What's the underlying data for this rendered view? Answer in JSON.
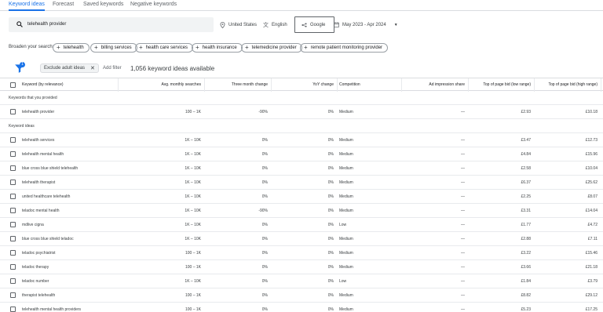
{
  "tabs": [
    {
      "label": "Keyword ideas",
      "active": true
    },
    {
      "label": "Forecast",
      "active": false
    },
    {
      "label": "Saved keywords",
      "active": false
    },
    {
      "label": "Negative keywords",
      "active": false
    }
  ],
  "search": {
    "value": "telehealth provider",
    "icon": "search-icon"
  },
  "options": {
    "location": "United States",
    "language": "English",
    "network": "Google",
    "date_range": "May 2023 - Apr 2024"
  },
  "broaden": {
    "label": "Broaden your search:",
    "chips": [
      "telehealth",
      "billing services",
      "health care services",
      "health insurance",
      "telemedicine provider",
      "remote patient monitoring provider"
    ]
  },
  "filters": {
    "badge": "1",
    "chip": "Exclude adult ideas",
    "add_filter": "Add filter",
    "count": "1,056 keyword ideas available"
  },
  "columns": [
    "Keyword (by relevance)",
    "Avg. monthly searches",
    "Three month change",
    "YoY change",
    "Competition",
    "Ad impression share",
    "Top of page bid (low range)",
    "Top of page bid (high range)"
  ],
  "sections": {
    "provided": "Keywords that you provided",
    "ideas": "Keyword ideas"
  },
  "provided_rows": [
    {
      "keyword": "telehealth provider",
      "searches": "100 – 1K",
      "three_month": "-90%",
      "yoy": "0%",
      "competition": "Medium",
      "share": "—",
      "low": "£2.93",
      "high": "£10.18"
    }
  ],
  "idea_rows": [
    {
      "keyword": "telehealth services",
      "searches": "1K – 10K",
      "three_month": "0%",
      "yoy": "0%",
      "competition": "Medium",
      "share": "—",
      "low": "£3.47",
      "high": "£12.73"
    },
    {
      "keyword": "telehealth mental health",
      "searches": "1K – 10K",
      "three_month": "0%",
      "yoy": "0%",
      "competition": "Medium",
      "share": "—",
      "low": "£4.84",
      "high": "£15.96"
    },
    {
      "keyword": "blue cross blue shield telehealth",
      "searches": "1K – 10K",
      "three_month": "0%",
      "yoy": "0%",
      "competition": "Medium",
      "share": "—",
      "low": "£2.58",
      "high": "£10.04"
    },
    {
      "keyword": "telehealth therapist",
      "searches": "1K – 10K",
      "three_month": "0%",
      "yoy": "0%",
      "competition": "Medium",
      "share": "—",
      "low": "£6.37",
      "high": "£25.62"
    },
    {
      "keyword": "united healthcare telehealth",
      "searches": "1K – 10K",
      "three_month": "0%",
      "yoy": "0%",
      "competition": "Medium",
      "share": "—",
      "low": "£2.25",
      "high": "£8.07"
    },
    {
      "keyword": "teladoc mental health",
      "searches": "1K – 10K",
      "three_month": "-90%",
      "yoy": "0%",
      "competition": "Medium",
      "share": "—",
      "low": "£3.31",
      "high": "£14.04"
    },
    {
      "keyword": "mdlive cigna",
      "searches": "1K – 10K",
      "three_month": "0%",
      "yoy": "0%",
      "competition": "Low",
      "share": "—",
      "low": "£1.77",
      "high": "£4.72"
    },
    {
      "keyword": "blue cross blue shield teladoc",
      "searches": "1K – 10K",
      "three_month": "0%",
      "yoy": "0%",
      "competition": "Medium",
      "share": "—",
      "low": "£2.88",
      "high": "£7.11"
    },
    {
      "keyword": "teladoc psychiatrist",
      "searches": "100 – 1K",
      "three_month": "0%",
      "yoy": "0%",
      "competition": "Medium",
      "share": "—",
      "low": "£3.22",
      "high": "£15.46"
    },
    {
      "keyword": "teladoc therapy",
      "searches": "100 – 1K",
      "three_month": "0%",
      "yoy": "0%",
      "competition": "Medium",
      "share": "—",
      "low": "£3.66",
      "high": "£21.18"
    },
    {
      "keyword": "teladoc number",
      "searches": "1K – 10K",
      "three_month": "0%",
      "yoy": "0%",
      "competition": "Low",
      "share": "—",
      "low": "£1.84",
      "high": "£3.79"
    },
    {
      "keyword": "therapist telehealth",
      "searches": "100 – 1K",
      "three_month": "0%",
      "yoy": "0%",
      "competition": "Medium",
      "share": "—",
      "low": "£8.82",
      "high": "£29.12"
    },
    {
      "keyword": "telehealth mental health providers",
      "searches": "100 – 1K",
      "three_month": "0%",
      "yoy": "0%",
      "competition": "Medium",
      "share": "—",
      "low": "£5.23",
      "high": "£17.25"
    }
  ]
}
